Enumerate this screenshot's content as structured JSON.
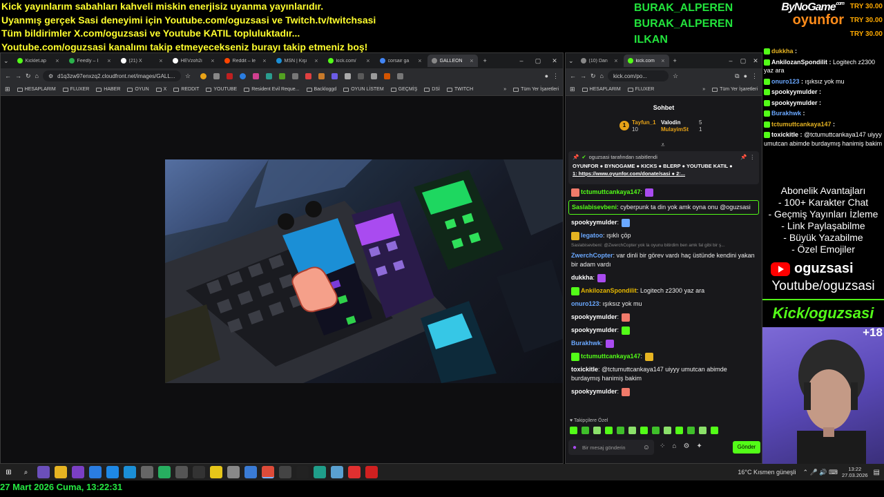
{
  "overlay": {
    "ticker_lines": [
      "Kick yayınlarım sabahları kahveli miskin enerjisiz uyanma yayınlarıdır.",
      "Uyanmış gerçek Sasi deneyimi için Youtube.com/oguzsasi ve Twitch.tv/twitchsasi",
      "Tüm bildirimler X.com/oguzsasi ve Youtube KATIL topluluktadır...",
      "Youtube.com/oguzsasi kanalımı takip etmeyecekseniz burayı takip etmeniz boş!"
    ],
    "donor_names": [
      "BURAK_ALPEREN",
      "BURAK_ALPEREN",
      "ILKAN"
    ],
    "brand_top": "ByNoGame",
    "brand_top_suffix": ".com",
    "brand_bottom": "oyunfor",
    "donations": [
      "TRY 30.00",
      "TRY 30.00",
      "TRY 30.00"
    ],
    "subscriber_header": "Abonelik Avantajları",
    "subscriber_perks": [
      "- 100+ Karakter Chat",
      "- Geçmiş Yayınları İzleme",
      "- Link Paylaşabilme",
      "- Büyük Yazabilme",
      "- Özel Emojiler"
    ],
    "youtube_handle": "oguzsasi",
    "youtube_text": "Youtube/oguzsasi",
    "kick_text": "Kick/oguzsasi",
    "age_badge": "+18",
    "datetime": "27 Mart 2026 Cuma, 13:22:31"
  },
  "right_chat": [
    {
      "user": "dukkha",
      "sep": " :",
      "msg": ""
    },
    {
      "user": "AnkilozanSpondilit",
      "sep": " :",
      "msg": " Logitech z2300 yaz ara"
    },
    {
      "user": "onuro123",
      "sep": " :",
      "msg": " ışıksız yok mu"
    },
    {
      "user": "spookyymulder",
      "sep": " :",
      "msg": ""
    },
    {
      "user": "spookyymulder",
      "sep": " :",
      "msg": ""
    },
    {
      "user": "Burakhwk",
      "sep": " :",
      "msg": ""
    },
    {
      "user": "tctumuttcankaya147",
      "sep": " :",
      "msg": ""
    },
    {
      "user": "toxickitle",
      "sep": " :",
      "msg": " @tctumuttcankaya147 uiyyy umutcan abimde burdaymış hanimiş bakim"
    }
  ],
  "colors": {
    "accent_green": "#53fc18",
    "ticker_yellow": "#ffff2e",
    "donor_green": "#22e33c",
    "donation_orange": "#ffaa00",
    "oyunfor_orange": "#ff8c1a"
  },
  "left_browser": {
    "tabs": [
      {
        "label": "Kicklet.ap",
        "icon": "kick-icon"
      },
      {
        "label": "Feedly – I",
        "icon": "feedly-icon"
      },
      {
        "label": "(21) X",
        "icon": "x-icon"
      },
      {
        "label": "HEVzoh2i",
        "icon": "x-icon"
      },
      {
        "label": "Reddit – le",
        "icon": "reddit-icon"
      },
      {
        "label": "MSN | Kişi",
        "icon": "msn-icon"
      },
      {
        "label": "kick.com/",
        "icon": "kick-icon"
      },
      {
        "label": "corsair ga",
        "icon": "google-icon"
      },
      {
        "label": "GALLEON",
        "icon": "page-icon"
      }
    ],
    "url": "d1q3zw97enxzq2.cloudfront.net/images/GALL...",
    "bookmarks": [
      "HESAPLARIM",
      "FLUXER",
      "HABER",
      "OYUN",
      "X",
      "REDDIT",
      "YOUTUBE",
      "Resident Evil Reque...",
      "Backloggd",
      "OYUN LİSTEM",
      "GEÇMİŞ",
      "DSİ",
      "TWITCH"
    ],
    "all_bookmarks": "Tüm Yer İşaretleri"
  },
  "right_browser": {
    "tabs": [
      {
        "label": "(10) Dan",
        "icon": "page-icon"
      },
      {
        "label": "kick.com",
        "icon": "kick-icon"
      }
    ],
    "url": "kick.com/po...",
    "bookmarks": [
      "HESAPLARIM",
      "FLUXER"
    ],
    "all_bookmarks": "Tüm Yer İşaretleri"
  },
  "kick_chat": {
    "header": "Sohbet",
    "leaderboard": [
      {
        "name": "Tayfun_1",
        "count": "10"
      },
      {
        "name": "Valodin",
        "count": "5"
      },
      {
        "name": "MulayimSt",
        "count": "1"
      }
    ],
    "pinned_by": "oguzsasi tarafından sabitlendi",
    "pinned_text": "OYUNFOR ● BYNOGAME ● KICKS ● BLERP ● YOUTUBE KATIL ●",
    "pinned_link": "1: https://www.oyunfor.com/donate/sasi ● 2:...",
    "messages": [
      {
        "user": "tctumuttcankaya147",
        "msg": "",
        "color": "#53fc18"
      },
      {
        "user": "Saslabisevbeni",
        "msg": " cyberpunk ta din yok amk oyna onu @oguzsasi",
        "color": "#53fc18"
      },
      {
        "user": "spookyymulder",
        "msg": "",
        "color": "#fff"
      },
      {
        "user": "legatoo",
        "msg": " ışıklı çöp",
        "color": "#6aa8ff"
      },
      {
        "user": "ZwerchCopter",
        "msg": " var dinli bir görev vardı haç üstünde kendini yakan bir adam vardı",
        "color": "#6aa8ff"
      },
      {
        "user": "dukkha",
        "msg": "",
        "color": "#fff"
      },
      {
        "user": "AnkilozanSpondilit",
        "msg": " Logitech z2300 yaz ara",
        "color": "#e6b800"
      },
      {
        "user": "onuro123",
        "msg": " ışıksız yok mu",
        "color": "#6aa8ff"
      },
      {
        "user": "spookyymulder",
        "msg": "",
        "color": "#fff"
      },
      {
        "user": "spookyymulder",
        "msg": "",
        "color": "#fff"
      },
      {
        "user": "Burakhwk",
        "msg": "",
        "color": "#6aa8ff"
      },
      {
        "user": "tctumuttcankaya147",
        "msg": "",
        "color": "#53fc18"
      },
      {
        "user": "toxickitle",
        "msg": " @tctumuttcankaya147 uiyyy umutcan abimde burdaymış hanimiş bakim",
        "color": "#fff"
      },
      {
        "user": "spookyymulder",
        "msg": "",
        "color": "#fff"
      }
    ],
    "reply_context": "Saslabisevbeni: @ZwerchCopter yok la oyunu bitirdim ben amk fal gibi bir ş...",
    "followers_only": "Takipçilere Özel",
    "input_placeholder": "Bir mesaj gönderin",
    "send_label": "Gönder"
  },
  "taskbar": {
    "weather": "16°C  Kısmen güneşli",
    "time": "13:22",
    "date": "27.03.2026"
  }
}
